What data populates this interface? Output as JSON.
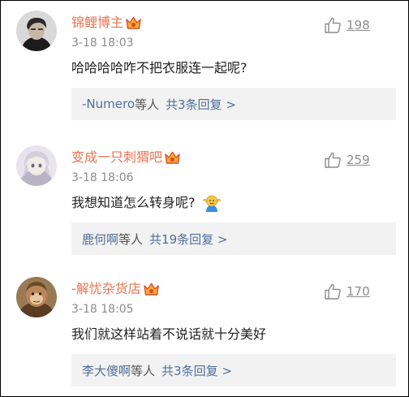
{
  "comments": [
    {
      "username": "锦鲤博主",
      "time": "3-18 18:03",
      "text": "哈哈哈哈咋不把衣服连一起呢?",
      "likes": "198",
      "reply_users": "-Numero",
      "reply_suffix": "等人",
      "reply_count": "共3条回复 >"
    },
    {
      "username": "变成一只刺猬吧",
      "time": "3-18 18:06",
      "text": "我想知道怎么转身呢?",
      "likes": "259",
      "reply_users": "鹿何啊",
      "reply_suffix": "等人",
      "reply_count": "共19条回复 >"
    },
    {
      "username": "-解忧杂货店",
      "time": "3-18 18:05",
      "text": "我们就这样站着不说话就十分美好",
      "likes": "170",
      "reply_users": "李大傻啊",
      "reply_suffix": "等人",
      "reply_count": "共3条回复 >"
    }
  ],
  "colors": {
    "username": "#eb7350",
    "link": "#4f6f9a",
    "meta": "#8c8c8c",
    "reply_bg": "#f2f2f2"
  },
  "icons": {
    "vip_badge": "vip-crown-icon",
    "like": "thumbs-up-icon",
    "emoji": "shrug-emoji-icon"
  }
}
